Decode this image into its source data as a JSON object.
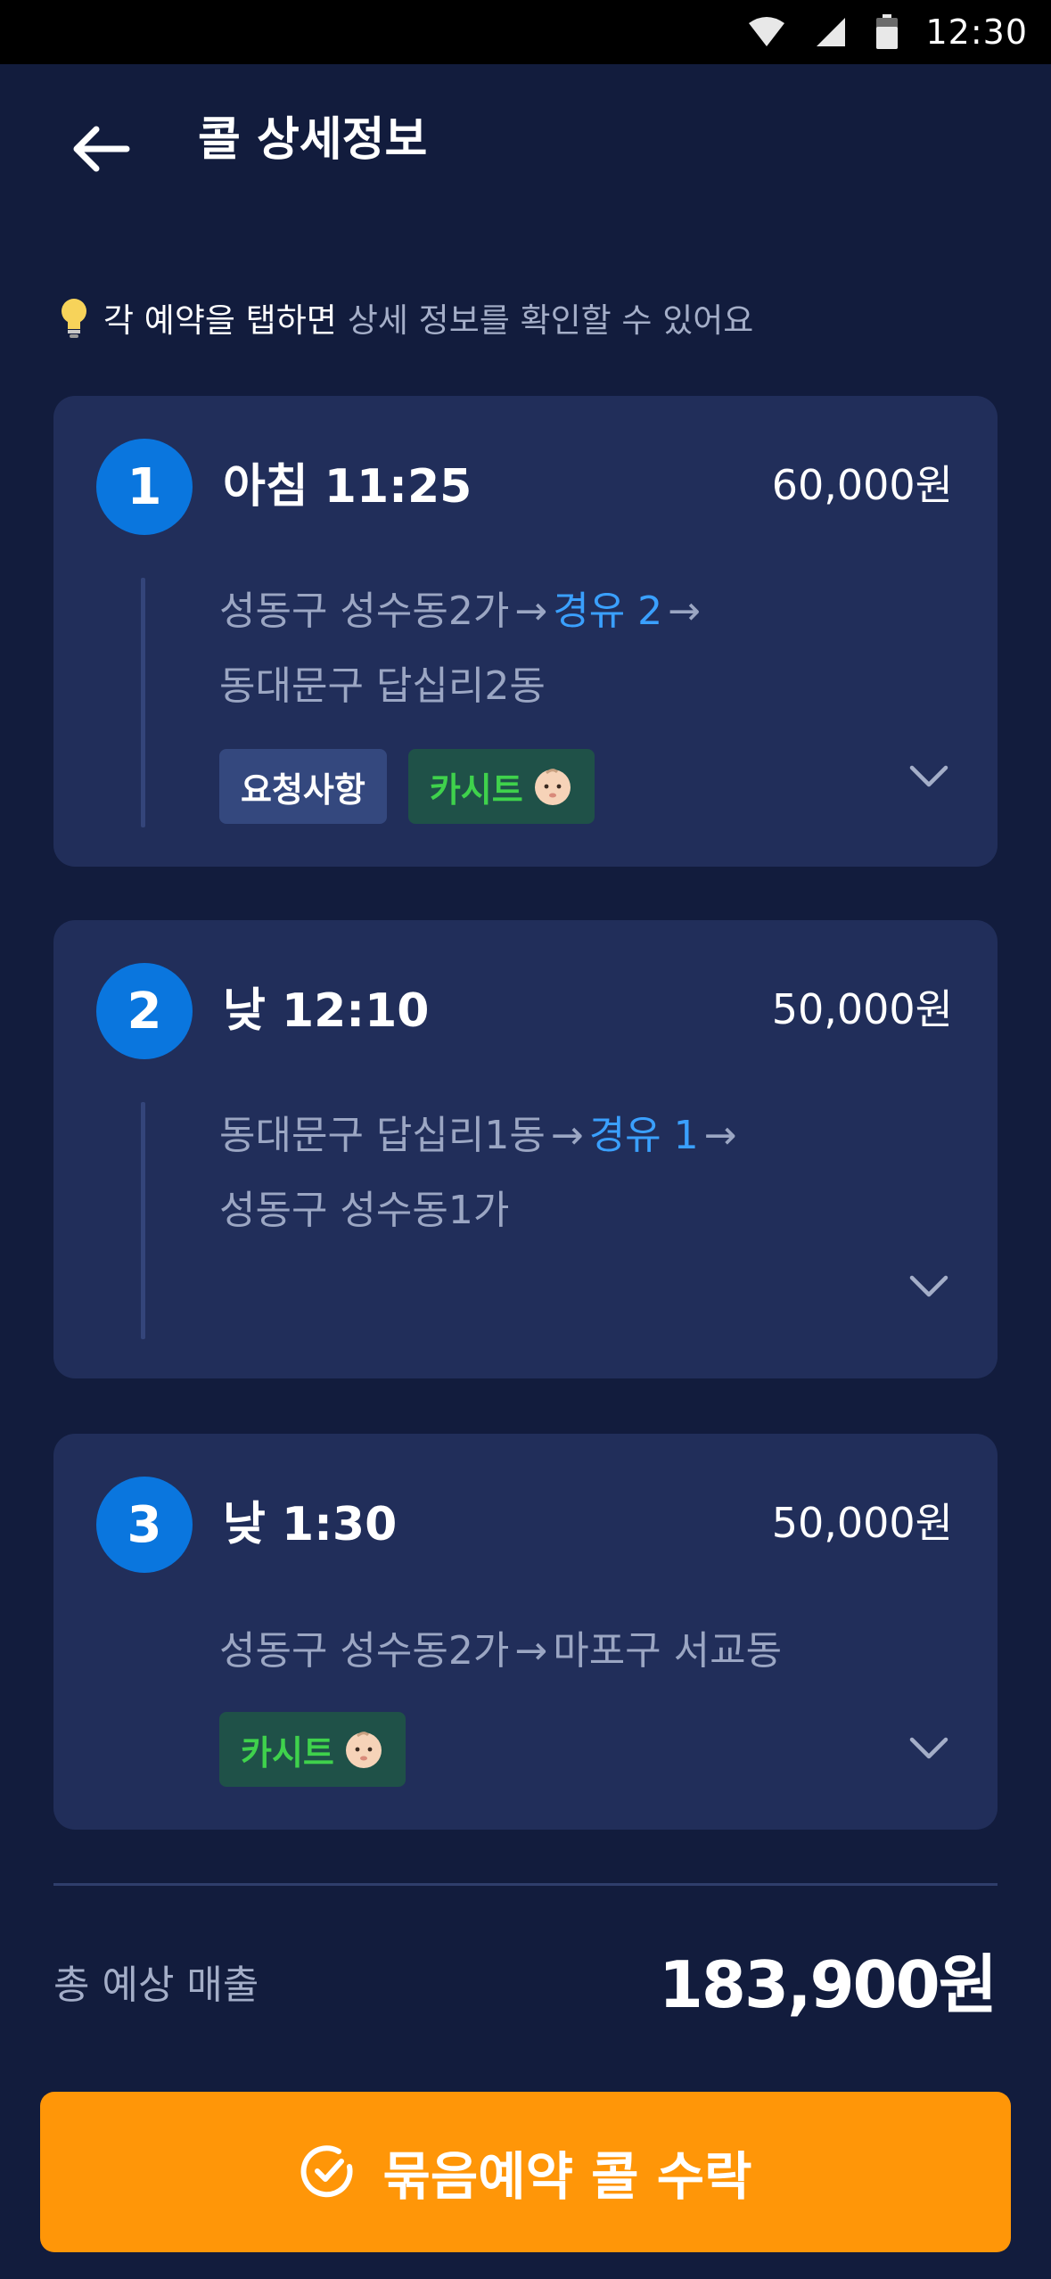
{
  "status_bar": {
    "time": "12:30"
  },
  "header": {
    "title": "콜 상세정보"
  },
  "hint": {
    "lead": "각 예약을 탭하면",
    "rest": "상세 정보를 확인할 수 있어요",
    "icon": "lightbulb-icon"
  },
  "calls": [
    {
      "number": "1",
      "time": "아침 11:25",
      "price": "60,000원",
      "route": {
        "origin": "성동구 성수동2가",
        "arrow1": "→",
        "waypoint": "경유 2",
        "arrow2": "→",
        "destination": "동대문구 답십리2동"
      },
      "tags": {
        "request": "요청사항",
        "carseat": "카시트"
      }
    },
    {
      "number": "2",
      "time": "낮 12:10",
      "price": "50,000원",
      "route": {
        "origin": "동대문구 답십리1동",
        "arrow1": "→",
        "waypoint": "경유 1",
        "arrow2": "→",
        "destination": "성동구 성수동1가"
      }
    },
    {
      "number": "3",
      "time": "낮 1:30",
      "price": "50,000원",
      "route": {
        "origin": "성동구 성수동2가",
        "arrow1": "→",
        "destination": "마포구 서교동"
      },
      "tags": {
        "carseat": "카시트"
      }
    }
  ],
  "summary": {
    "label": "총 예상 매출",
    "value": "183,900원"
  },
  "action": {
    "label": "묶음예약 콜 수락"
  },
  "colors": {
    "background": "#121c3d",
    "card": "#212e5a",
    "accent_blue": "#0a76de",
    "waypoint": "#3aa0ff",
    "carseat_green": "#3fd24c",
    "cta_orange": "#ff9608"
  }
}
